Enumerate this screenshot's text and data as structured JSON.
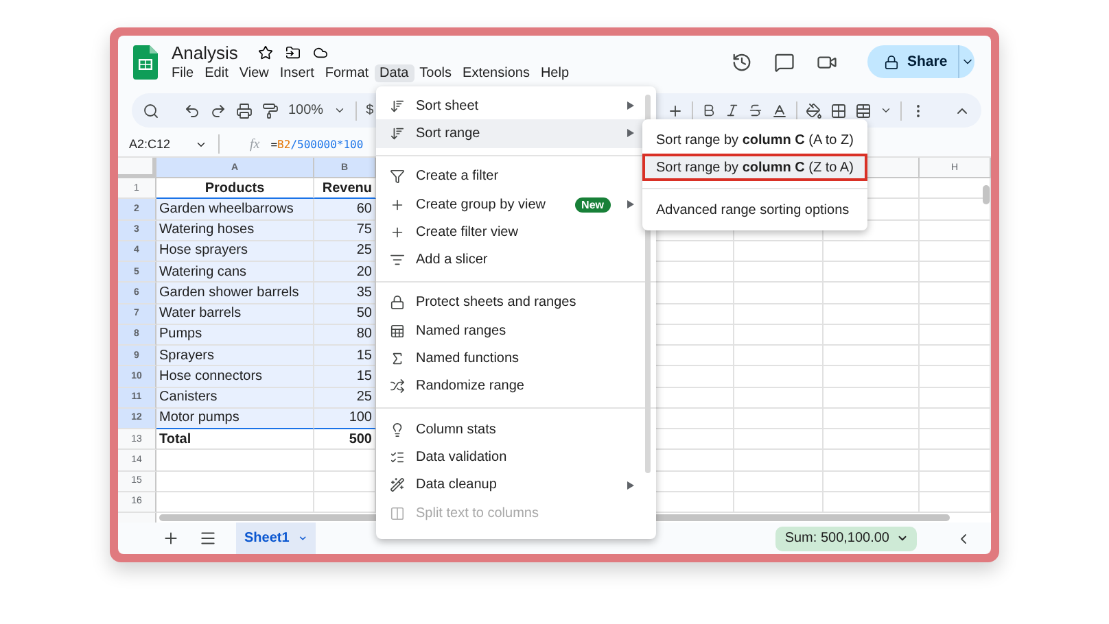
{
  "document": {
    "title": "Analysis"
  },
  "menu_bar": [
    {
      "label": "File",
      "selected": false
    },
    {
      "label": "Edit",
      "selected": false
    },
    {
      "label": "View",
      "selected": false
    },
    {
      "label": "Insert",
      "selected": false
    },
    {
      "label": "Format",
      "selected": false
    },
    {
      "label": "Data",
      "selected": true
    },
    {
      "label": "Tools",
      "selected": false
    },
    {
      "label": "Extensions",
      "selected": false
    },
    {
      "label": "Help",
      "selected": false
    }
  ],
  "share_button": {
    "label": "Share"
  },
  "toolbar": {
    "zoom": "100%",
    "currency": "$"
  },
  "formula_bar": {
    "name_box": "A2:C12",
    "fx": "fx",
    "formula": [
      {
        "text": "=",
        "kind": "operator"
      },
      {
        "text": "B2",
        "kind": "reference"
      },
      {
        "text": "/500000*100",
        "kind": "number"
      }
    ]
  },
  "sheet": {
    "columns": [
      {
        "label": "A",
        "selected": true
      },
      {
        "label": "B",
        "selected": true
      },
      {
        "label": "H",
        "selected": false
      }
    ],
    "rows": [
      {
        "number": "1",
        "kind": "header",
        "selected": false,
        "cells": [
          "Products",
          "Revenu"
        ]
      },
      {
        "number": "2",
        "kind": "data",
        "selected": true,
        "cells": [
          "Garden wheelbarrows",
          "60"
        ]
      },
      {
        "number": "3",
        "kind": "data",
        "selected": true,
        "cells": [
          "Watering hoses",
          "75"
        ]
      },
      {
        "number": "4",
        "kind": "data",
        "selected": true,
        "cells": [
          "Hose sprayers",
          "25"
        ]
      },
      {
        "number": "5",
        "kind": "data",
        "selected": true,
        "cells": [
          "Watering cans",
          "20"
        ]
      },
      {
        "number": "6",
        "kind": "data",
        "selected": true,
        "cells": [
          "Garden shower barrels",
          "35"
        ]
      },
      {
        "number": "7",
        "kind": "data",
        "selected": true,
        "cells": [
          "Water barrels",
          "50"
        ]
      },
      {
        "number": "8",
        "kind": "data",
        "selected": true,
        "cells": [
          "Pumps",
          "80"
        ]
      },
      {
        "number": "9",
        "kind": "data",
        "selected": true,
        "cells": [
          "Sprayers",
          "15"
        ]
      },
      {
        "number": "10",
        "kind": "data",
        "selected": true,
        "cells": [
          "Hose connectors",
          "15"
        ]
      },
      {
        "number": "11",
        "kind": "data",
        "selected": true,
        "cells": [
          "Canisters",
          "25"
        ]
      },
      {
        "number": "12",
        "kind": "data",
        "selected": true,
        "cells": [
          "Motor pumps",
          "100"
        ]
      },
      {
        "number": "13",
        "kind": "total",
        "selected": false,
        "cells": [
          "Total",
          "500"
        ]
      },
      {
        "number": "14",
        "kind": "empty",
        "selected": false
      },
      {
        "number": "15",
        "kind": "empty",
        "selected": false
      },
      {
        "number": "16",
        "kind": "empty",
        "selected": false
      }
    ]
  },
  "data_menu": {
    "sections": [
      [
        {
          "label": "Sort sheet",
          "submenu": true,
          "selected": false,
          "disabled": false
        },
        {
          "label": "Sort range",
          "submenu": true,
          "selected": true,
          "disabled": false
        }
      ],
      [
        {
          "label": "Create a filter",
          "submenu": false,
          "selected": false,
          "disabled": false
        },
        {
          "label": "Create group by view",
          "submenu": true,
          "selected": false,
          "disabled": false,
          "badge": "New"
        },
        {
          "label": "Create filter view",
          "submenu": false,
          "selected": false,
          "disabled": false
        },
        {
          "label": "Add a slicer",
          "submenu": false,
          "selected": false,
          "disabled": false
        }
      ],
      [
        {
          "label": "Protect sheets and ranges",
          "submenu": false,
          "selected": false,
          "disabled": false
        },
        {
          "label": "Named ranges",
          "submenu": false,
          "selected": false,
          "disabled": false
        },
        {
          "label": "Named functions",
          "submenu": false,
          "selected": false,
          "disabled": false
        },
        {
          "label": "Randomize range",
          "submenu": false,
          "selected": false,
          "disabled": false
        }
      ],
      [
        {
          "label": "Column stats",
          "submenu": false,
          "selected": false,
          "disabled": false
        },
        {
          "label": "Data validation",
          "submenu": false,
          "selected": false,
          "disabled": false
        },
        {
          "label": "Data cleanup",
          "submenu": true,
          "selected": false,
          "disabled": false
        },
        {
          "label": "Split text to columns",
          "submenu": false,
          "selected": false,
          "disabled": true
        }
      ]
    ]
  },
  "sort_range_submenu": {
    "sections": [
      [
        {
          "label": "Sort range by **column C** (A to Z)",
          "selected": false
        },
        {
          "label": "Sort range by **column C** (Z to A)",
          "selected": true
        }
      ],
      [
        {
          "label": "Advanced range sorting options",
          "selected": false
        }
      ]
    ]
  },
  "bottom_bar": {
    "sheets": [
      {
        "label": "Sheet1",
        "selected": true
      }
    ],
    "sum": "Sum: 500,100.00"
  }
}
